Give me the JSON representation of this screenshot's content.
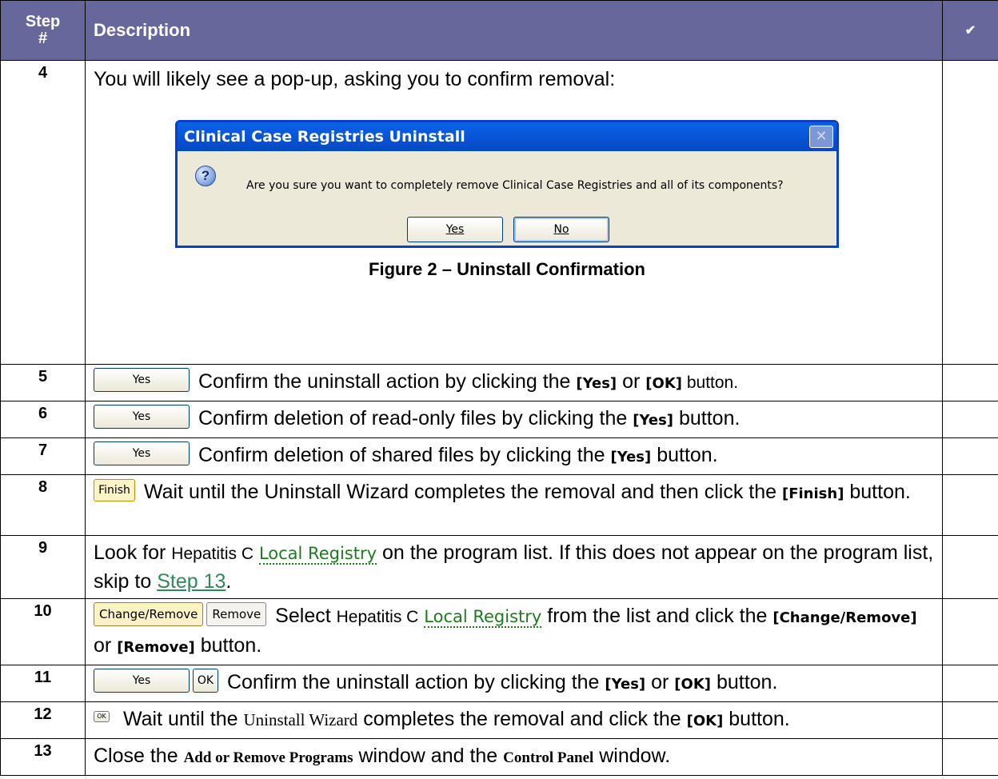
{
  "header": {
    "step_line1": "Step",
    "step_line2": "#",
    "description": "Description",
    "check": "✔"
  },
  "dialog": {
    "title": "Clinical Case Registries Uninstall",
    "close": "✕",
    "question_icon": "question-icon",
    "message": "Are you sure you want to completely remove Clinical Case Registries and all of its components?",
    "yes": "Yes",
    "no": "No"
  },
  "rows": [
    {
      "num": "4",
      "text": "You will likely see a pop-up, asking you to confirm removal:",
      "caption": "Figure 2 – Uninstall Confirmation"
    },
    {
      "num": "5",
      "btn": "Yes",
      "t1": " Confirm the uninstall action by clicking the ",
      "b1": "[Yes]",
      "t2": " or ",
      "b2": "[OK]",
      "t3": " button."
    },
    {
      "num": "6",
      "btn": "Yes",
      "t1": " Confirm deletion of read-only files by clicking the ",
      "b1": "[Yes]",
      "t2": " button."
    },
    {
      "num": "7",
      "btn": "Yes",
      "t1": " Confirm deletion of shared files by clicking the ",
      "b1": "[Yes]",
      "t2": " button."
    },
    {
      "num": "8",
      "btn": "Finish",
      "t1": " Wait until the Uninstall Wizard completes the removal and then click the ",
      "b1": "[Finish]",
      "t2": " button."
    },
    {
      "num": "9",
      "t1": "Look for ",
      "s1": "Hepatitis C",
      "link": "Local Registry",
      "t2": " on the program list. If this does not appear on the program list, skip to ",
      "link2": "Step 13",
      "t3": "."
    },
    {
      "num": "10",
      "btn1": "Change/Remove",
      "btn2": "Remove",
      "t1": " Select ",
      "s1": "Hepatitis C",
      "link": "Local Registry",
      "t2": " from the list and click the ",
      "b1": "[Change/Remove]",
      "t3": " or ",
      "b2": "[Remove]",
      "t4": " button."
    },
    {
      "num": "11",
      "btn1": "Yes",
      "btn2": "OK",
      "t1": " Confirm the uninstall action by clicking the ",
      "b1": "[Yes]",
      "t2": " or ",
      "b2": "[OK]",
      "t3": " button."
    },
    {
      "num": "12",
      "btn": "OK",
      "t1": " Wait until the ",
      "s1": "Uninstall Wizard",
      "t2": " completes the removal and click the ",
      "b1": "[OK]",
      "t3": " button."
    },
    {
      "num": "13",
      "t1": "Close the ",
      "s1": "Add or Remove Programs",
      "t2": " window and the ",
      "s2": "Control Panel",
      "t3": " window."
    }
  ]
}
